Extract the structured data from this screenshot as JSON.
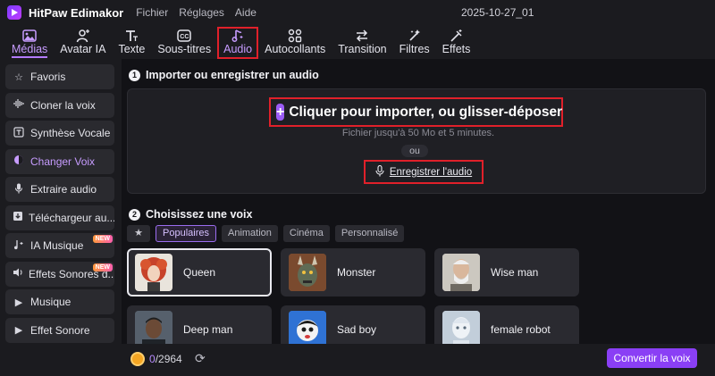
{
  "app": {
    "name": "HitPaw Edimakor",
    "menu": [
      "Fichier",
      "Réglages",
      "Aide"
    ],
    "document_title": "2025-10-27_01"
  },
  "toolbar": {
    "tabs": [
      {
        "label": "Médias",
        "icon": "media-icon",
        "active": true
      },
      {
        "label": "Avatar IA",
        "icon": "avatar-icon",
        "active": false
      },
      {
        "label": "Texte",
        "icon": "text-icon",
        "active": false
      },
      {
        "label": "Sous-titres",
        "icon": "subtitles-icon",
        "active": false
      },
      {
        "label": "Audio",
        "icon": "audio-icon",
        "active": false,
        "highlighted": true
      },
      {
        "label": "Autocollants",
        "icon": "stickers-icon",
        "active": false
      },
      {
        "label": "Transition",
        "icon": "transition-icon",
        "active": false
      },
      {
        "label": "Filtres",
        "icon": "filters-icon",
        "active": false
      },
      {
        "label": "Effets",
        "icon": "effects-icon",
        "active": false
      }
    ]
  },
  "sidebar": {
    "items": [
      {
        "label": "Favoris",
        "icon": "star-icon"
      },
      {
        "label": "Cloner la voix",
        "icon": "waveform-icon"
      },
      {
        "label": "Synthèse Vocale",
        "icon": "text-to-speech-icon"
      },
      {
        "label": "Changer Voix",
        "icon": "voice-changer-icon",
        "active": true
      },
      {
        "label": "Extraire audio",
        "icon": "microphone-icon"
      },
      {
        "label": "Téléchargeur au...",
        "icon": "download-icon"
      },
      {
        "label": "IA Musique",
        "icon": "ai-music-icon",
        "badge": "NEW"
      },
      {
        "label": "Effets Sonores d...",
        "icon": "sound-effects-icon",
        "badge": "NEW"
      },
      {
        "label": "Musique",
        "icon": "play-icon"
      },
      {
        "label": "Effet Sonore",
        "icon": "play-icon"
      }
    ]
  },
  "import_section": {
    "step": "1",
    "title": "Importer ou enregistrer un audio",
    "import_label": "Cliquer pour importer, ou glisser-déposer",
    "plus_glyph": "+",
    "limit_text": "Fichier jusqu'à 50 Mo et 5 minutes.",
    "or_text": "ou",
    "record_label": "Enregistrer l'audio"
  },
  "voice_section": {
    "step": "2",
    "title": "Choisissez une voix",
    "filters": [
      {
        "label": "Populaires",
        "selected": true
      },
      {
        "label": "Animation",
        "selected": false
      },
      {
        "label": "Cinéma",
        "selected": false
      },
      {
        "label": "Personnalisé",
        "selected": false
      }
    ],
    "voices": [
      {
        "name": "Queen",
        "selected": true
      },
      {
        "name": "Monster",
        "selected": false
      },
      {
        "name": "Wise man",
        "selected": false
      },
      {
        "name": "Deep man",
        "selected": false
      },
      {
        "name": "Sad boy",
        "selected": false
      },
      {
        "name": "female robot",
        "selected": false
      }
    ]
  },
  "bottom": {
    "credits_used": "0",
    "credits_total": "/2964",
    "convert_label": "Convertir la voix"
  },
  "colors": {
    "accent": "#8a3ff5",
    "highlight_box": "#e0202a",
    "background": "#121216"
  }
}
